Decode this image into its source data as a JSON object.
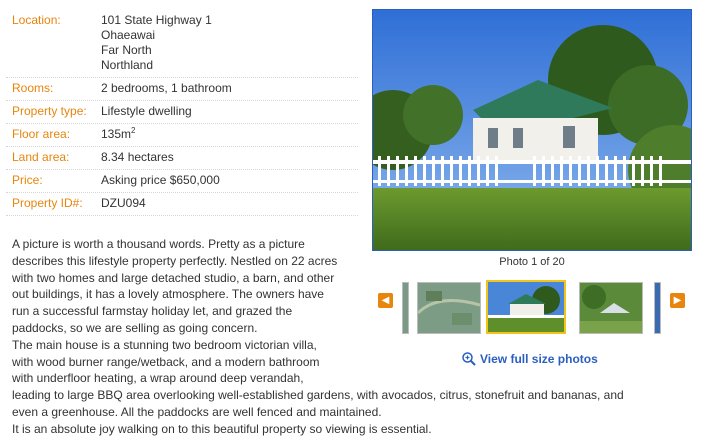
{
  "details": [
    {
      "key": "Location:",
      "lines": [
        "101 State Highway 1",
        "Ohaeawai",
        "Far North",
        "Northland"
      ]
    },
    {
      "key": "Rooms:",
      "value": "2 bedrooms, 1 bathroom"
    },
    {
      "key": "Property type:",
      "value": "Lifestyle dwelling"
    },
    {
      "key": "Floor area:",
      "value": "135m",
      "sup": "2"
    },
    {
      "key": "Land area:",
      "value": "8.34 hectares"
    },
    {
      "key": "Price:",
      "value": "Asking price $650,000"
    },
    {
      "key": "Property ID#:",
      "value": "DZU094"
    }
  ],
  "description": {
    "narrow_lines": [
      "A picture is worth a thousand words. Pretty as a picture",
      "describes this lifestyle property perfectly. Nestled on 22 acres",
      "with two homes and large detached studio, a barn, and other",
      "out buildings, it has a lovely atmosphere. The owners have",
      "run a successful farmstay holiday let, and grazed the",
      "paddocks, so we are selling as going concern.",
      "The main house is a stunning two bedroom victorian villa,",
      "with wood burner range/wetback, and a modern bathroom",
      "with underfloor heating, a wrap around deep verandah,"
    ],
    "wide_lines": [
      "leading to large BBQ area overlooking well-established gardens, with avocados, citrus, stonefruit and bananas, and",
      "even a greenhouse. All the paddocks are well fenced and maintained.",
      "It is an absolute joy walking on to this beautiful property so viewing is essential."
    ]
  },
  "gallery": {
    "counter": "Photo 1 of 20",
    "prev_glyph": "◀",
    "next_glyph": "▶",
    "view_full": "View full size photos"
  },
  "colors": {
    "accent": "#e8850c",
    "link": "#2a5fbf",
    "selected": "#f0c419"
  }
}
